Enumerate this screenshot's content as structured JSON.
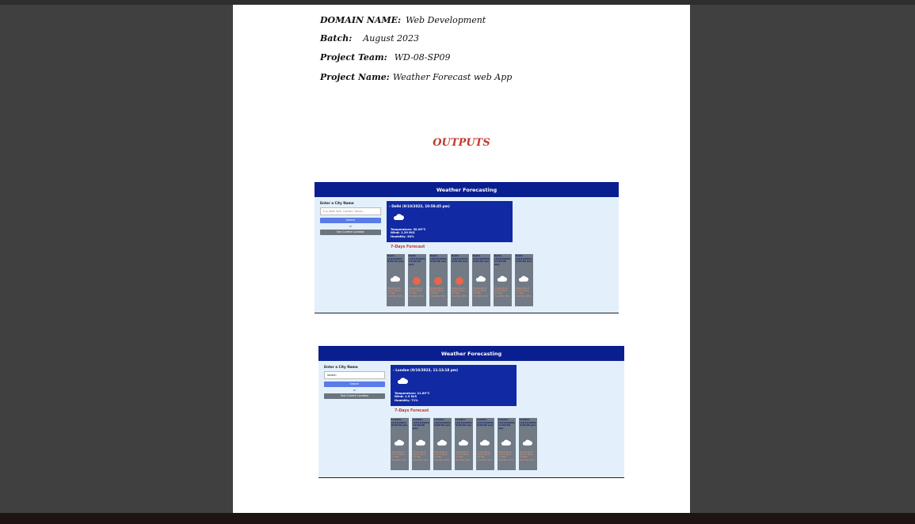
{
  "document": {
    "rows": [
      {
        "key": "DOMAIN NAME:",
        "value": "Web Development"
      },
      {
        "key": "Batch:",
        "value": "August  2023"
      },
      {
        "key": "Project Team:",
        "value": "WD-08-SP09"
      },
      {
        "key": "Project Name:",
        "value": "Weather Forecast web App"
      }
    ],
    "section_title": "OUTPUTS"
  },
  "screens": [
    {
      "header": "Weather Forecasting",
      "city_label": "Enter a City Name",
      "input_placeholder": "E.g.,New York, London, Tokyo...",
      "input_value": "",
      "search_label": "Search",
      "or_label": "or",
      "location_label": "Use Current Location",
      "current_title": "- Delhi (9/10/2023, 10:58:45 pm)",
      "current_details": [
        "Temperature: 30.09°C",
        "Wind: 1.29 M/S",
        "Humidity: 54%"
      ],
      "forecast_title": "7-Days Forecast",
      "forecast_cards": [
        {
          "date": "Delhi (9/10/2023, 8:00:00 pm)",
          "icon": "cloud-icon",
          "details": "Temperature: 30.1°C Wind: 1.3 M/S Humidity: 54%"
        },
        {
          "date": "Delhi (10/10/2023, 11:00:00 pm)",
          "icon": "sun-icon",
          "details": "Temperature: 27.7°C Wind: 2.3 M/S Humidity: 52%"
        },
        {
          "date": "Delhi (10/10/2023, 2:00:00 am)",
          "icon": "sun-icon",
          "details": "Temperature: 25.9°C Wind: 1.9 M/S Humidity: 56%"
        },
        {
          "date": "Delhi (10/10/2023, 5:00:00 am)",
          "icon": "sun-icon",
          "details": "Temperature: 24.8°C Wind: 1.6 M/S Humidity: 58%"
        },
        {
          "date": "Delhi (10/10/2023, 8:00:00 am)",
          "icon": "cloud-icon",
          "details": "Temperature: 28.3°C Wind: 1.9 M/S Humidity: 49%"
        },
        {
          "date": "Delhi (10/10/2023, 11:00:00 am)",
          "icon": "cloud-icon",
          "details": "Temperature: 32.5°C Wind: 2.1 M/S Humidity: 38%"
        },
        {
          "date": "Delhi (10/10/2023, 2:00:00 pm)",
          "icon": "cloud-icon",
          "details": "Temperature: 33.6°C Wind: 2.7 M/S Humidity: 34%"
        }
      ]
    },
    {
      "header": "Weather Forecasting",
      "city_label": "Enter a City Name",
      "input_placeholder": "",
      "input_value": "london",
      "search_label": "Search",
      "or_label": "or",
      "location_label": "Use Current Location",
      "current_title": "- London (9/10/2023, 11:13:18 pm)",
      "current_details": [
        "Temperature: 21.69°C",
        "Wind: 1.5 M/S",
        "Humidity: 71%"
      ],
      "forecast_title": "7-Days Forecast",
      "forecast_cards": [
        {
          "date": "London (9/10/2023, 8:00:00 pm)",
          "icon": "cloud-icon",
          "details": "Temperature: 21.7°C Wind: 1.5 M/S Humidity: 71%"
        },
        {
          "date": "London (10/10/2023, 11:00:00 pm)",
          "icon": "cloud-icon",
          "details": "Temperature: 19.4°C Wind: 1.8 M/S Humidity: 78%"
        },
        {
          "date": "London (10/10/2023, 2:00:00 am)",
          "icon": "cloud-icon",
          "details": "Temperature: 18.2°C Wind: 2.0 M/S Humidity: 83%"
        },
        {
          "date": "London (10/10/2023, 5:00:00 am)",
          "icon": "cloud-icon",
          "details": "Temperature: 17.6°C Wind: 2.2 M/S Humidity: 86%"
        },
        {
          "date": "London (10/10/2023, 8:00:00 am)",
          "icon": "cloud-icon",
          "details": "Temperature: 18.9°C Wind: 2.6 M/S Humidity: 80%"
        },
        {
          "date": "London (10/10/2023, 11:00:00 am)",
          "icon": "cloud-icon",
          "details": "Temperature: 21.3°C Wind: 3.1 M/S Humidity: 67%"
        },
        {
          "date": "London (10/10/2023, 2:00:00 pm)",
          "icon": "cloud-icon",
          "details": "Temperature: 22.4°C Wind: 3.4 M/S Humidity: 61%"
        }
      ]
    }
  ]
}
